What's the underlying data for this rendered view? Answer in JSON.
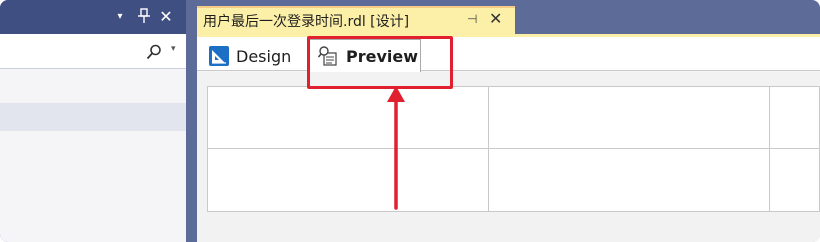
{
  "left_panel": {
    "title_buttons": {
      "menu_glyph": "▾",
      "pin_glyph": "📌",
      "close_glyph": "✕"
    },
    "search": {
      "icon": "search-icon",
      "dropdown_glyph": "▾"
    }
  },
  "document_tab": {
    "title": "用户最后一次登录时间.rdl [设计]",
    "pin_glyph": "⊣",
    "close_glyph": "✕"
  },
  "view_tabs": {
    "design_label": "Design",
    "preview_label": "Preview",
    "active": "Preview"
  },
  "icons": {
    "design": "design-ruler-icon",
    "preview": "preview-magnifier-icon"
  },
  "colors": {
    "title_bar": "#3f4f82",
    "chrome": "#5d6b99",
    "doc_tab": "#fcf0a8",
    "highlight": "#e0202e"
  }
}
